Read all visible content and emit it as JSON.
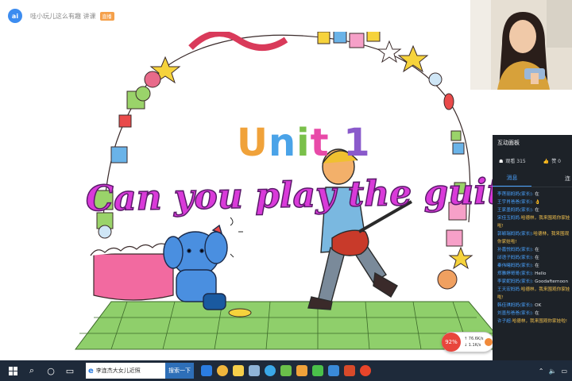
{
  "topbar": {
    "app_icon": "app-logo-icon",
    "app_icon_text": "ai",
    "title": "哇小玩儿这么有趣 讲课",
    "tag": "直播"
  },
  "slide": {
    "unit_title": [
      "U",
      "n",
      "i",
      "t",
      " 1"
    ],
    "lesson_title": "Can you play the guitar?"
  },
  "net_widget": {
    "percent": "92%",
    "up_rate": "↑ 76.6K/s",
    "down_rate": "↓ 1.1K/s"
  },
  "panel": {
    "header": "互动面板",
    "viewers_label": "观看 315",
    "likes_label": "赞 0",
    "tabs": [
      "消息",
      "连"
    ],
    "chat": [
      {
        "nick": "李莲丽妈妈(家长):",
        "msg": " 在"
      },
      {
        "nick": "王宇肖爸爸(家长):",
        "msg": " 👌"
      },
      {
        "nick": "王家墨妈妈(家长):",
        "msg": " 在"
      },
      {
        "nick": "宋佳玉妈妈:",
        "msg": "",
        "tall": "哈德林，我来围观你家娃啦!"
      },
      {
        "nick": "郭颖瑞妈妈(家长):",
        "msg": "",
        "tall": "哈德林，我来围观你家娃啦!"
      },
      {
        "nick": "孙嘉悦妈妈(家长):",
        "msg": " 在"
      },
      {
        "nick": "邱语子妈妈(家长):",
        "msg": " 在"
      },
      {
        "nick": "秦伟曦妈妈(家长):",
        "msg": " 在"
      },
      {
        "nick": "郑雅婷哥哥(家长):",
        "msg": " Hello"
      },
      {
        "nick": "李家妮妈妈(家长):",
        "msg": " Goodafternoon"
      },
      {
        "nick": "王天宏妈妈:",
        "msg": "",
        "tall": "哈德林，我来围观你家娃啦!"
      },
      {
        "nick": "韩佳琪妈妈(家长):",
        "msg": " OK"
      },
      {
        "nick": "刘墨彤爸爸(家长):",
        "msg": " 在"
      },
      {
        "nick": "许子超:",
        "msg": "",
        "tall": "哈德林，我来围观你家娃啦!"
      }
    ]
  },
  "taskbar": {
    "search_text": "李连杰大女儿近照",
    "search_button": "搜索一下",
    "apps": [
      "edge-icon",
      "chrome-icon",
      "folder-icon",
      "store-icon",
      "qq-icon",
      "wps-icon",
      "live-icon",
      "wechat-icon",
      "arrow-icon",
      "office-icon",
      "media-icon"
    ]
  },
  "colors": {
    "panel_bg": "#1d2228",
    "chat_nick": "#4aa3ff",
    "lesson_title": "#d93ad9",
    "taskbar_bg": "#1e2a3a"
  }
}
